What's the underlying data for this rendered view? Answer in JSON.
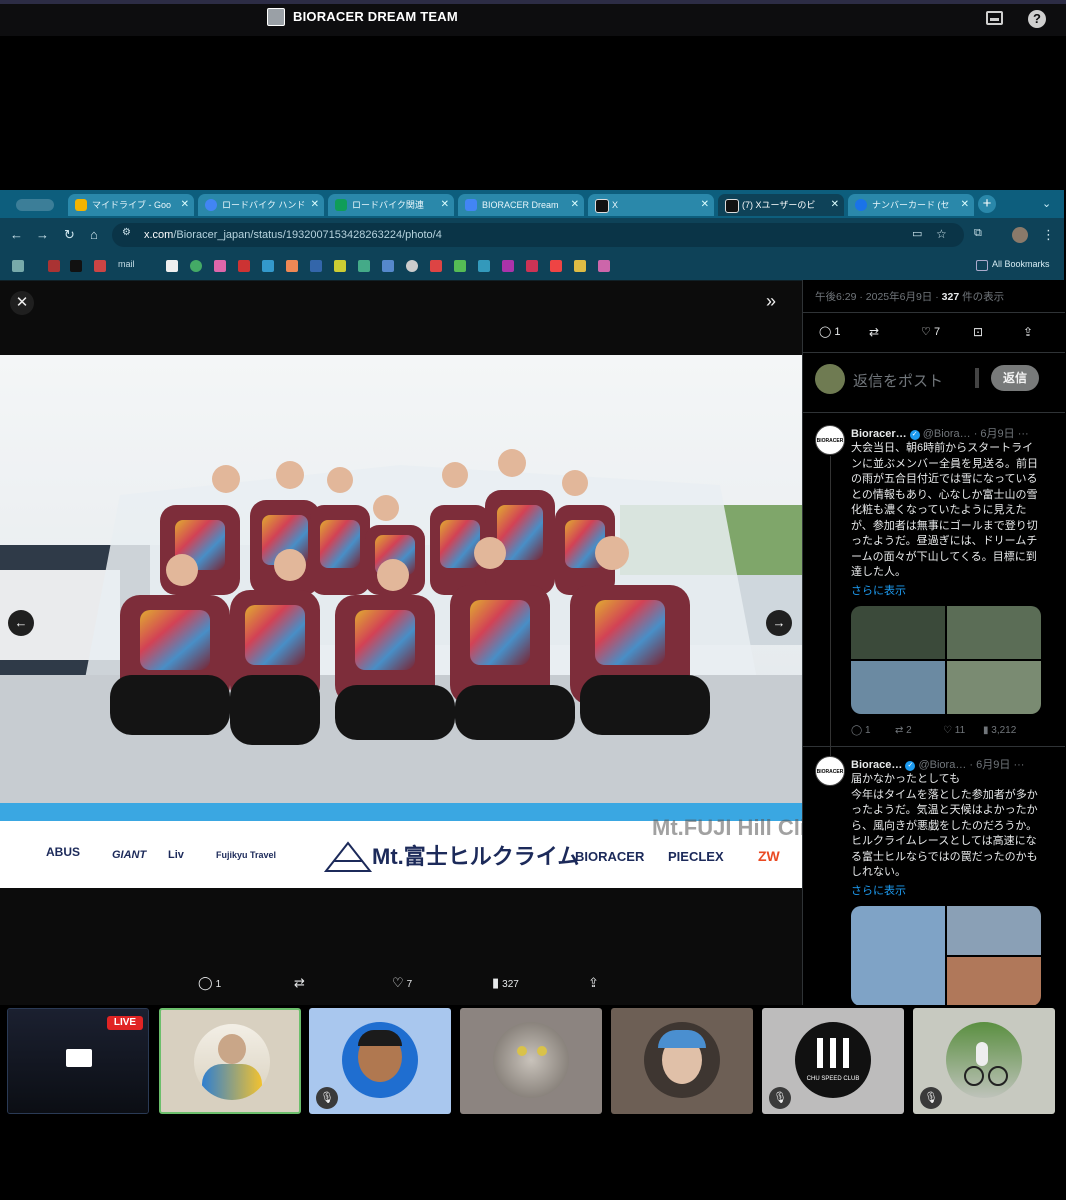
{
  "meeting": {
    "title": "BIORACER DREAM TEAM"
  },
  "browser": {
    "tabs": [
      {
        "label": "マイドライブ - Goo",
        "color": "#f4b400"
      },
      {
        "label": "ロードバイク ハンド",
        "color": "#4285f4"
      },
      {
        "label": "ロードバイク関連",
        "color": "#0f9d58"
      },
      {
        "label": "BIORACER Dream",
        "color": "#4285f4"
      },
      {
        "label": "X",
        "color": "#000000"
      },
      {
        "label": "(7) Xユーザーのビ",
        "color": "#000000"
      },
      {
        "label": "ナンバーカード (セ",
        "color": "#1a73e8"
      }
    ],
    "url": {
      "domain": "x.com",
      "path": "/Bioracer_japan/status/1932007153428263224/photo/4"
    },
    "bookmarks": {
      "mail": "mail",
      "all": "All Bookmarks"
    }
  },
  "post": {
    "timestamp": "午後6:29 · 2025年6月9日 · ",
    "views": "327",
    "views_suffix": " 件の表示",
    "replies": "1",
    "likes": "7",
    "reply_placeholder": "返信をポスト",
    "reply_button": "返信",
    "photo_actions": {
      "replies": "1",
      "likes": "7",
      "views": "327"
    }
  },
  "thread": [
    {
      "name": "Bioracer…",
      "handle": "@Biora…",
      "date": "· 6月9日",
      "text": "大会当日、朝6時前からスタートラインに並ぶメンバー全員を見送る。前日の雨が五合目付近では雪になっているとの情報もあり、心なしか富士山の雪化粧も濃くなっていたように見えたが、参加者は無事にゴールまで登り切ったようだ。昼過ぎには、ドリームチームの面々が下山してくる。目標に到達した人。",
      "more": "さらに表示",
      "replies": "1",
      "reposts": "2",
      "likes": "11",
      "views": "3,212"
    },
    {
      "name": "Biorace…",
      "handle": "@Biora…",
      "date": "· 6月9日",
      "text": "届かなかったとしても\n今年はタイムを落とした参加者が多かったようだ。気温と天候はよかったから、風向きが悪戯をしたのだろうか。ヒルクライムレースとしては高速になる富士ヒルならではの罠だったのかもしれない。",
      "more": "さらに表示"
    }
  ],
  "photo": {
    "banner_left": [
      "ABUS",
      "GIANT",
      "Liv",
      "Fujikyu Travel"
    ],
    "banner_main": "Mt.富士ヒルクライム",
    "banner_right": [
      "BIORACER",
      "PIECLEX",
      "ZW"
    ],
    "watermark": "Mt.FUJI Hill Climb"
  },
  "participants": [
    {
      "kind": "screen",
      "badge": "LIVE"
    },
    {
      "kind": "avatar",
      "bg": "#d8d0c0",
      "muted": false,
      "active": true
    },
    {
      "kind": "avatar",
      "bg": "#a9c7ee",
      "muted": true
    },
    {
      "kind": "avatar",
      "bg": "#8c8480",
      "muted": false
    },
    {
      "kind": "avatar",
      "bg": "#6d5f55",
      "muted": false
    },
    {
      "kind": "avatar",
      "bg": "#bdbcbc",
      "muted": true,
      "label": "CHU SPEED CLUB"
    },
    {
      "kind": "avatar",
      "bg": "#c7c9c0",
      "muted": true
    }
  ]
}
